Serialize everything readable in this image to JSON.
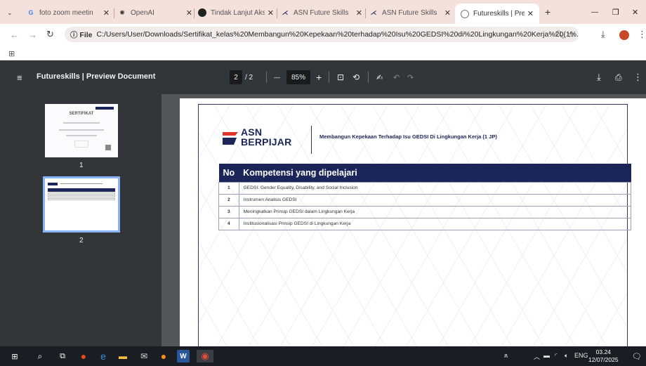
{
  "browser": {
    "tabs": [
      {
        "title": "foto zoom meetin",
        "icon": "google-icon",
        "active": false
      },
      {
        "title": "OpenAI",
        "icon": "openai-icon",
        "active": false
      },
      {
        "title": "Tindak Lanjut Aksi",
        "icon": "chatgpt-icon",
        "active": false
      },
      {
        "title": "ASN Future Skills",
        "icon": "asn-icon",
        "active": false
      },
      {
        "title": "ASN Future Skills",
        "icon": "asn-icon",
        "active": false
      },
      {
        "title": "Futureskills | Previ",
        "icon": "globe-icon",
        "active": true
      }
    ],
    "new_tab": "+",
    "window_controls": {
      "minimize": "—",
      "restore": "❐",
      "close": "✕"
    },
    "address": {
      "chip": "ⓘ File",
      "url": "C:/Users/User/Downloads/Sertifikat_kelas%20Membangun%20Kepekaan%20terhadap%20Isu%20GEDSI%20di%20Lingkungan%20Kerja%20(1%..."
    }
  },
  "viewer": {
    "title": "Futureskills | Preview Document",
    "page_current": "2",
    "page_total": "/ 2",
    "zoom": "85%",
    "minus": "—",
    "plus": "+"
  },
  "sidebar": {
    "thumbnails": [
      {
        "number": "1",
        "label": "SERTIFIKAT"
      },
      {
        "number": "2"
      }
    ]
  },
  "document": {
    "logo": {
      "line1": "ASN",
      "line2": "BERPIJAR"
    },
    "heading": "Membangun Kepekaan Terhadap Isu GEDSI Di Lingkungan Kerja (1 JP)",
    "table": {
      "headers": [
        "No",
        "Kompetensi yang dipelajari"
      ],
      "rows": [
        {
          "no": "1",
          "text": "GEDSI: Gender Equality, Disability, and Social Inclusion"
        },
        {
          "no": "2",
          "text": "Instrumen Analisis GEDSI"
        },
        {
          "no": "3",
          "text": "Meningkatkan Prinsip GEDSI dalam Lingkungan Kerja"
        },
        {
          "no": "4",
          "text": "Institusionalisasi Prinsip GEDSI di Lingkungan Kerja"
        }
      ]
    }
  },
  "taskbar": {
    "lang": "ENG",
    "time": "03.24",
    "date": "12/07/2025"
  },
  "colors": {
    "tabstrip": "#f5e1dc",
    "viewer_bar": "#323639",
    "navy": "#1c2559",
    "logo_red": "#e2332b"
  }
}
